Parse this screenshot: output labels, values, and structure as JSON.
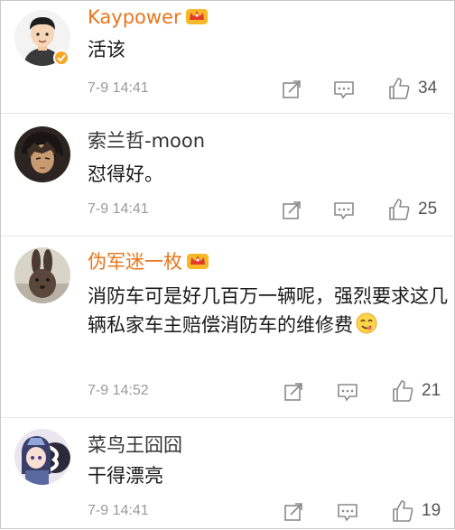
{
  "comments": [
    {
      "username": "Kaypower",
      "vip": true,
      "verified": true,
      "text": "活该",
      "time": "7-9 14:41",
      "likes": "34"
    },
    {
      "username": "索兰哲-moon",
      "vip": false,
      "verified": false,
      "text": "怼得好。",
      "time": "7-9 14:41",
      "likes": "25"
    },
    {
      "username": "伪军迷一枚",
      "vip": true,
      "verified": false,
      "text": "消防车可是好几百万一辆呢，强烈要求这几辆私家车主赔偿消防车的维修费",
      "emoji": "yummy-face-emoji",
      "time": "7-9 14:52",
      "likes": "21"
    },
    {
      "username": "菜鸟王囧囧",
      "vip": false,
      "verified": false,
      "text": "干得漂亮",
      "time": "7-9 14:41",
      "likes": "19"
    }
  ],
  "icons": {
    "share": "share-icon",
    "comment": "comment-icon",
    "like": "thumbs-up-icon",
    "vip": "crown-icon"
  },
  "colors": {
    "vip_username": "#e8761d",
    "username": "#333333",
    "timestamp": "#9a9a9a",
    "icon": "#8a8a8a"
  }
}
